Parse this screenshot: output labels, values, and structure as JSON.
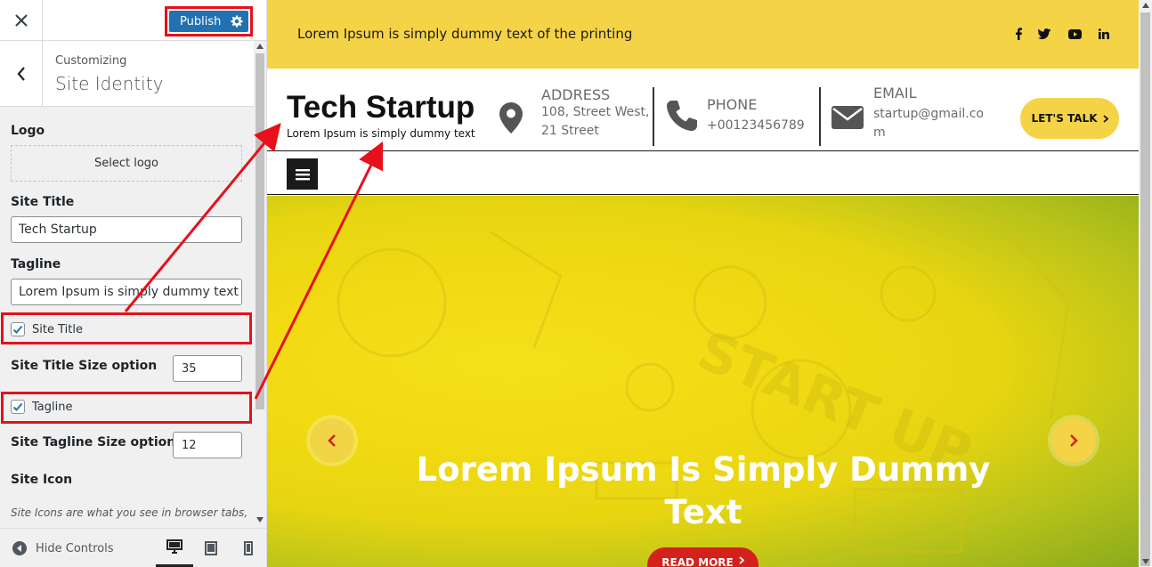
{
  "customizer": {
    "close_icon": "close-icon",
    "publish_label": "Publish",
    "customizing_label": "Customizing",
    "section_title": "Site Identity",
    "logo_label": "Logo",
    "select_logo_label": "Select logo",
    "site_title_label": "Site Title",
    "site_title_value": "Tech Startup",
    "tagline_label": "Tagline",
    "tagline_value": "Lorem Ipsum is simply dummy text",
    "show_site_title_label": "Site Title",
    "show_site_title_checked": true,
    "site_title_size_label": "Site Title Size option",
    "site_title_size_value": "35",
    "show_tagline_label": "Tagline",
    "show_tagline_checked": true,
    "site_tagline_size_label": "Site Tagline Size option",
    "site_tagline_size_value": "12",
    "site_icon_label": "Site Icon",
    "site_icon_description": "Site Icons are what you see in browser tabs,",
    "hide_controls_label": "Hide Controls",
    "active_device": "desktop"
  },
  "preview": {
    "top_text": "Lorem Ipsum is simply dummy text of the printing",
    "social_icons": [
      "facebook-icon",
      "twitter-icon",
      "youtube-icon",
      "linkedin-icon"
    ],
    "brand_title": "Tech Startup",
    "brand_tagline": "Lorem Ipsum is simply dummy text",
    "address_label": "ADDRESS",
    "address_line1": "108, Street West,",
    "address_line2": "21 Street",
    "phone_label": "PHONE",
    "phone_value": "+00123456789",
    "email_label": "EMAIL",
    "email_line1": "startup@gmail.co",
    "email_line2": "m",
    "lets_talk_label": "LET'S TALK",
    "hero_title": "Lorem Ipsum Is Simply Dummy Text",
    "read_more_label": "READ MORE",
    "hero_watermark": "START UP"
  },
  "colors": {
    "accent_yellow": "#f5d347",
    "publish_blue": "#2271b1",
    "annotation_red": "#e8101a",
    "read_more_red": "#d3211b"
  }
}
